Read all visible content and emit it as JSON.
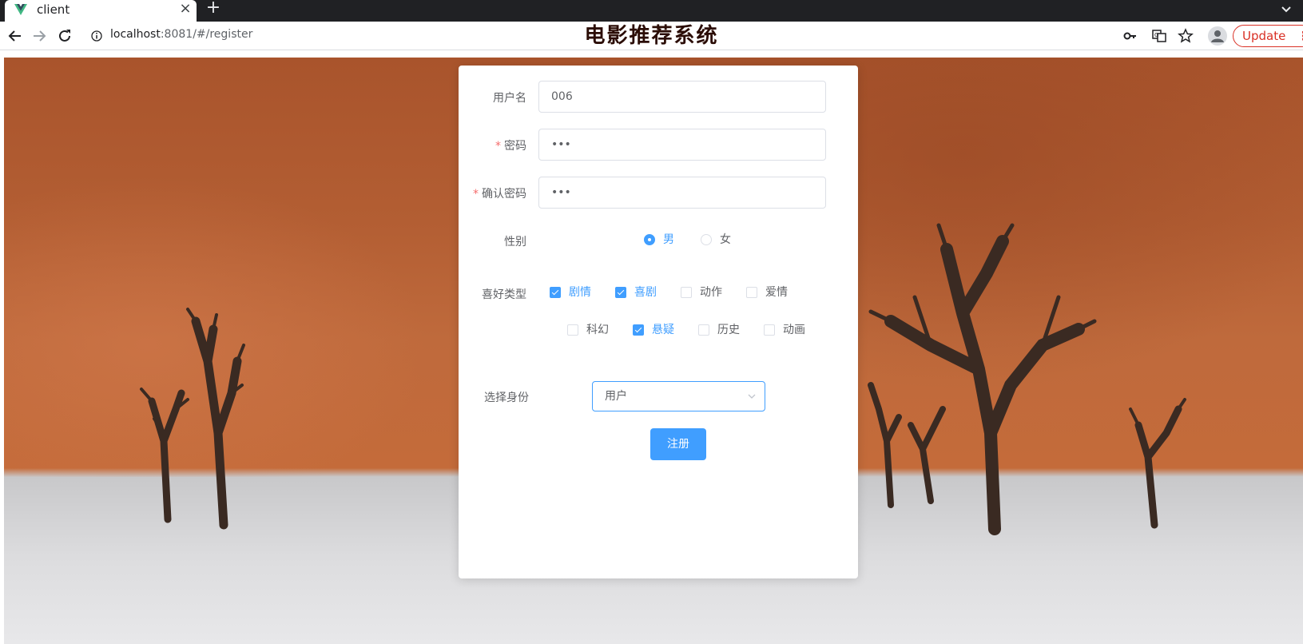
{
  "browser": {
    "tab_title": "client",
    "tab_close": "×",
    "new_tab": "+",
    "url_host": "localhost",
    "url_rest": ":8081/#/register",
    "update_label": "Update",
    "update_dots": "⋮",
    "icons": [
      "back-arrow-icon",
      "forward-arrow-icon",
      "reload-icon",
      "info-icon",
      "key-icon",
      "translate-icon",
      "star-icon",
      "profile-icon"
    ]
  },
  "page": {
    "title": "电影推荐系统"
  },
  "form": {
    "username": {
      "label": "用户名",
      "value": "006"
    },
    "password": {
      "required_mark": "*",
      "label": "密码",
      "value": "•••"
    },
    "confirm_password": {
      "required_mark": "*",
      "label": "确认密码",
      "value": "•••"
    },
    "gender": {
      "label": "性别",
      "options": [
        {
          "label": "男",
          "selected": true
        },
        {
          "label": "女",
          "selected": false
        }
      ]
    },
    "preferences": {
      "label": "喜好类型",
      "options": [
        {
          "label": "剧情",
          "checked": true
        },
        {
          "label": "喜剧",
          "checked": true
        },
        {
          "label": "动作",
          "checked": false
        },
        {
          "label": "爱情",
          "checked": false
        },
        {
          "label": "科幻",
          "checked": false
        },
        {
          "label": "悬疑",
          "checked": true
        },
        {
          "label": "历史",
          "checked": false
        },
        {
          "label": "动画",
          "checked": false
        }
      ]
    },
    "identity": {
      "label": "选择身份",
      "value": "用户"
    },
    "submit_label": "注册"
  },
  "colors": {
    "primary": "#409eff",
    "required": "#f56c6c",
    "title": "#2b0d06",
    "update": "#d93025"
  }
}
